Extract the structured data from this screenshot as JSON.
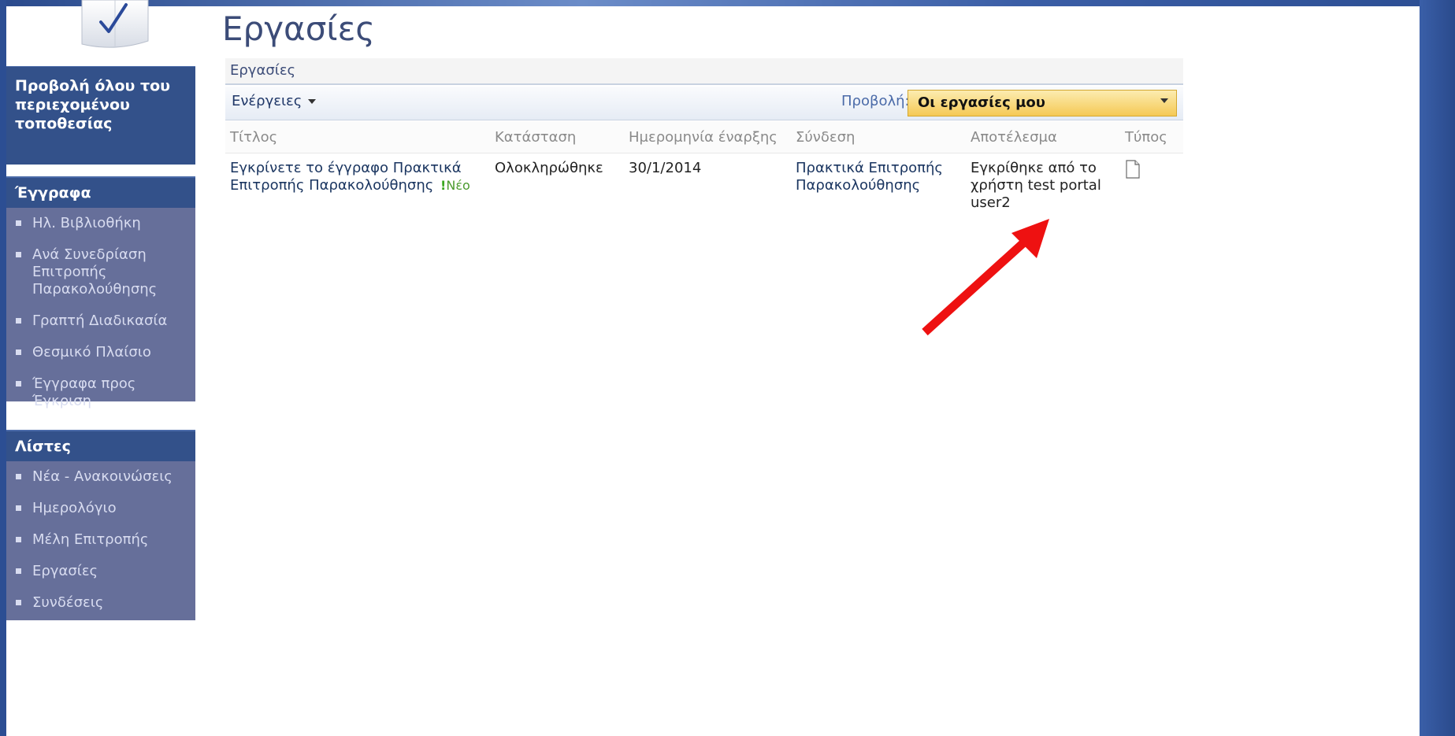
{
  "page": {
    "title": "Εργασίες",
    "breadcrumb": "Εργασίες"
  },
  "toolbar": {
    "actions_label": "Ενέργειες",
    "view_label": "Προβολή:",
    "view_value": "Οι εργασίες μου"
  },
  "sidebar": {
    "view_all": "Προβολή όλου του περιεχομένου τοποθεσίας",
    "documents": {
      "header": "Έγγραφα",
      "items": [
        {
          "label": "Ηλ. Βιβλιοθήκη"
        },
        {
          "label": "Ανά Συνεδρίαση Επιτροπής Παρακολούθησης"
        },
        {
          "label": "Γραπτή Διαδικασία"
        },
        {
          "label": "Θεσμικό Πλαίσιο"
        },
        {
          "label": "Έγγραφα προς Έγκριση"
        }
      ]
    },
    "lists": {
      "header": "Λίστες",
      "items": [
        {
          "label": "Νέα - Ανακοινώσεις"
        },
        {
          "label": "Ημερολόγιο"
        },
        {
          "label": "Μέλη Επιτροπής"
        },
        {
          "label": "Εργασίες"
        },
        {
          "label": "Συνδέσεις"
        }
      ]
    }
  },
  "table": {
    "columns": {
      "title": "Τίτλος",
      "status": "Κατάσταση",
      "start_date": "Ημερομηνία έναρξης",
      "link": "Σύνδεση",
      "result": "Αποτέλεσμα",
      "type": "Τύπος"
    },
    "rows": [
      {
        "title": "Εγκρίνετε το έγγραφο Πρακτικά Επιτροπής Παρακολούθησης",
        "new_mark": "!",
        "new_label": "Νέο",
        "status": "Ολοκληρώθηκε",
        "start_date": "30/1/2014",
        "link": "Πρακτικά Επιτροπής Παρακολούθησης",
        "result": "Εγκρίθηκε από το χρήστη test portal user2",
        "type_icon": "document-icon"
      }
    ]
  },
  "annotation": {
    "arrow_color": "#ee1111"
  }
}
